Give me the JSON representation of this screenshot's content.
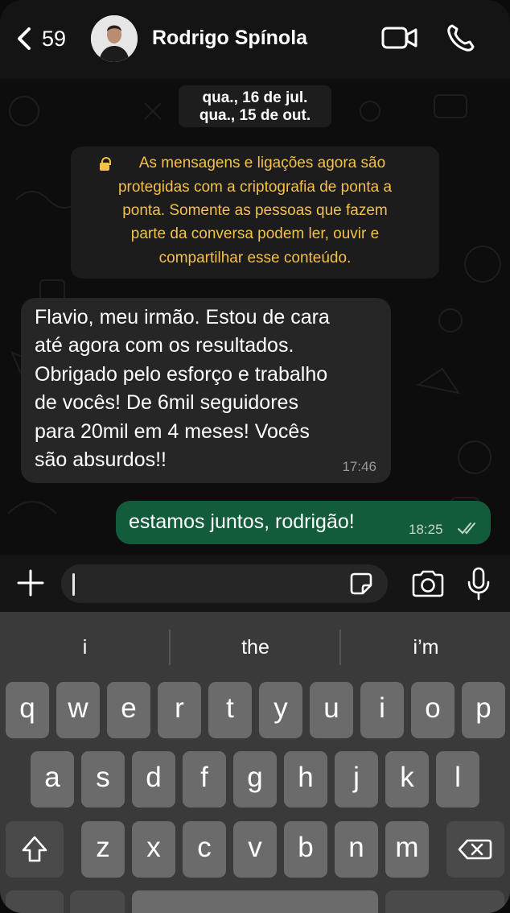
{
  "header": {
    "unread_count": "59",
    "contact_name": "Rodrigo Spínola"
  },
  "chat": {
    "date_badge": [
      "qua., 16 de jul.",
      "qua., 15 de out."
    ],
    "encryption_notice": [
      "As mensagens e ligações agora são",
      "protegidas com a criptografia de ponta a",
      "ponta. Somente as pessoas que fazem",
      "parte da conversa podem ler, ouvir e",
      "compartilhar esse conteúdo."
    ],
    "messages": [
      {
        "direction": "incoming",
        "lines": [
          "Flavio, meu irmão. Estou de cara",
          "até agora com os resultados.",
          "Obrigado pelo esforço e trabalho",
          "de vocês! De 6mil seguidores",
          "para 20mil em 4 meses! Vocês",
          "são absurdos!!"
        ],
        "time": "17:46"
      },
      {
        "direction": "outgoing",
        "text": "estamos juntos, rodrigão!",
        "time": "18:25",
        "status": "read"
      }
    ]
  },
  "composer": {
    "placeholder": ""
  },
  "keyboard": {
    "suggestions": [
      "i",
      "the",
      "i’m"
    ],
    "rows": [
      [
        "q",
        "w",
        "e",
        "r",
        "t",
        "y",
        "u",
        "i",
        "o",
        "p"
      ],
      [
        "a",
        "s",
        "d",
        "f",
        "g",
        "h",
        "j",
        "k",
        "l"
      ],
      [
        "z",
        "x",
        "c",
        "v",
        "b",
        "n",
        "m"
      ]
    ]
  },
  "colors": {
    "outgoing_bubble": "#125c3b",
    "incoming_bubble": "#262626",
    "system_text": "#f4c04b",
    "keyboard_bg": "#3a3a3a",
    "key_bg": "#6b6b6b"
  }
}
